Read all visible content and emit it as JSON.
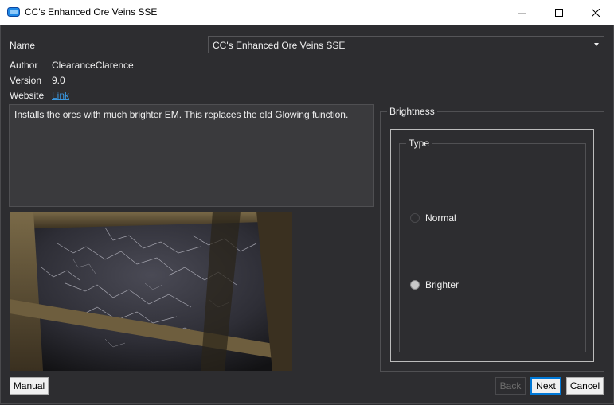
{
  "window": {
    "title": "CC's Enhanced Ore Veins SSE",
    "controls": [
      "minimize-icon",
      "maximize-icon",
      "close-icon"
    ]
  },
  "info": {
    "name_label": "Name",
    "name_value": "CC's Enhanced Ore Veins SSE",
    "author_label": "Author",
    "author_value": "ClearanceClarence",
    "version_label": "Version",
    "version_value": "9.0",
    "website_label": "Website",
    "website_link": "Link"
  },
  "description": "Installs the ores with much brighter EM. This replaces the old Glowing function.",
  "options": {
    "group_title": "Brightness",
    "subgroup_title": "Type",
    "choices": [
      {
        "label": "Normal",
        "selected": false
      },
      {
        "label": "Brighter",
        "selected": true
      }
    ]
  },
  "buttons": {
    "manual": "Manual",
    "back": "Back",
    "next": "Next",
    "cancel": "Cancel"
  },
  "colors": {
    "background": "#2d2d30",
    "link": "#3a96dd",
    "accent": "#0078d7"
  }
}
